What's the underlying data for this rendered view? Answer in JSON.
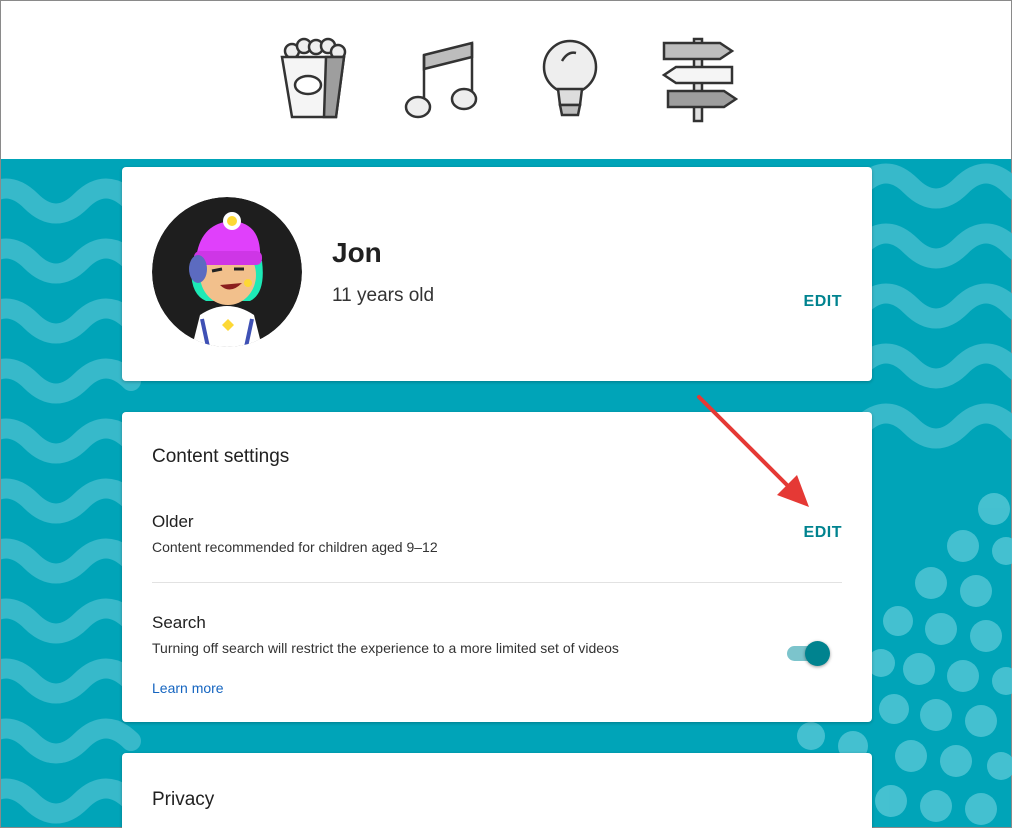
{
  "header": {
    "icons": [
      "popcorn-icon",
      "music-note-icon",
      "lightbulb-icon",
      "signpost-icon"
    ]
  },
  "profile": {
    "name": "Jon",
    "age": "11 years old",
    "edit_label": "EDIT"
  },
  "content_settings": {
    "title": "Content settings",
    "level": {
      "title": "Older",
      "description": "Content recommended for children aged 9–12",
      "edit_label": "EDIT"
    },
    "search": {
      "title": "Search",
      "description": "Turning off search will restrict the experience to a more limited set of videos",
      "enabled": true,
      "learn_more": "Learn more"
    }
  },
  "privacy": {
    "title": "Privacy"
  },
  "colors": {
    "accent": "#00838f",
    "background": "#00a4b8",
    "annotation_arrow": "#e53935"
  }
}
